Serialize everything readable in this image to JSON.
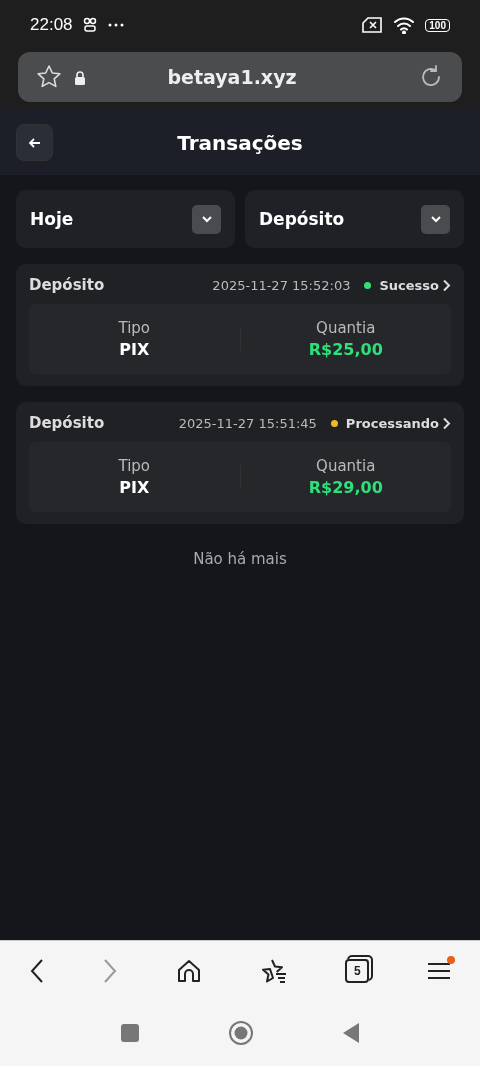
{
  "status_bar": {
    "time": "22:08",
    "battery": "100"
  },
  "address_bar": {
    "url": "betaya1.xyz"
  },
  "header": {
    "title": "Transações"
  },
  "filters": [
    {
      "label": "Hoje"
    },
    {
      "label": "Depósito"
    }
  ],
  "transactions": [
    {
      "title": "Depósito",
      "datetime": "2025-11-27 15:52:03",
      "status": "Sucesso",
      "color": "#2ee07a",
      "type_label": "Tipo",
      "type": "PIX",
      "amount_label": "Quantia",
      "amount": "R$25,00"
    },
    {
      "title": "Depósito",
      "datetime": "2025-11-27 15:51:45",
      "status": "Processando",
      "color": "#f0b928",
      "type_label": "Tipo",
      "type": "PIX",
      "amount_label": "Quantia",
      "amount": "R$29,00"
    }
  ],
  "end_note": "Não há mais",
  "browser_nav": {
    "back_disabled": false,
    "forward_disabled": true,
    "tab_count": "5",
    "menu_badge": true
  }
}
